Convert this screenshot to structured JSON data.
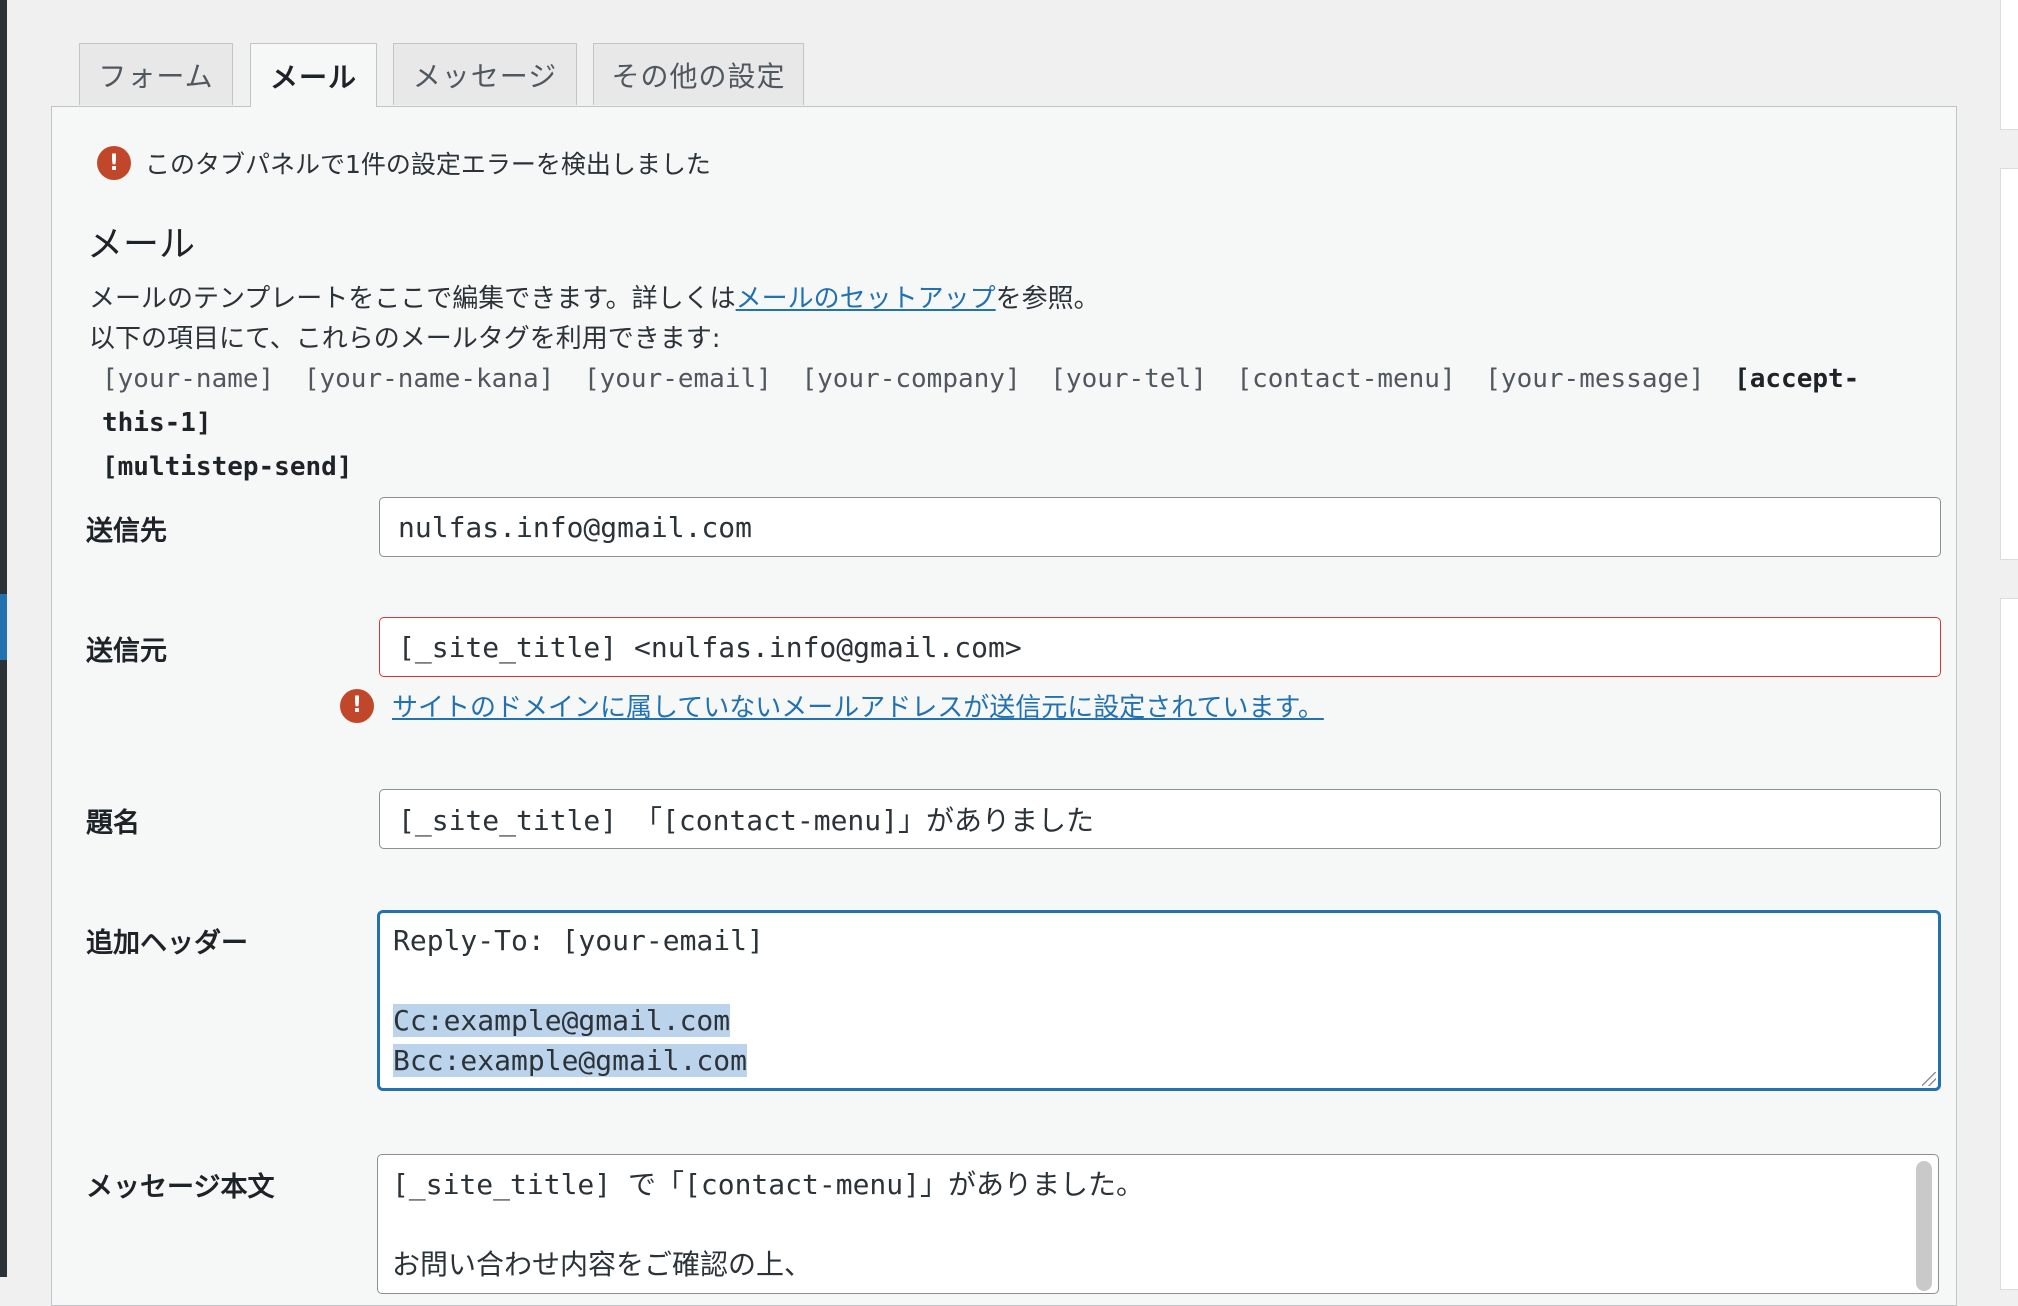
{
  "tabs": [
    {
      "label": "フォーム",
      "active": false
    },
    {
      "label": "メール",
      "active": true
    },
    {
      "label": "メッセージ",
      "active": false
    },
    {
      "label": "その他の設定",
      "active": false
    }
  ],
  "panel": {
    "error_summary": "このタブパネルで1件の設定エラーを検出しました",
    "section_title": "メール",
    "description_before_link": "メールのテンプレートをここで編集できます。詳しくは",
    "description_link": "メールのセットアップ",
    "description_after_link": "を参照。",
    "mailtags_intro": "以下の項目にて、これらのメールタグを利用できます:",
    "mailtags": [
      "[your-name]",
      "[your-name-kana]",
      "[your-email]",
      "[your-company]",
      "[your-tel]",
      "[contact-menu]",
      "[your-message]"
    ],
    "mailtags_used": [
      "[accept-this-1]",
      "[multistep-send]"
    ]
  },
  "fields": {
    "to": {
      "label": "送信先",
      "value": "nulfas.info@gmail.com"
    },
    "from": {
      "label": "送信元",
      "value": "[_site_title] <nulfas.info@gmail.com>",
      "error": "サイトのドメインに属していないメールアドレスが送信元に設定されています。"
    },
    "subject": {
      "label": "題名",
      "value": "[_site_title] 「[contact-menu]」がありました"
    },
    "headers": {
      "label": "追加ヘッダー",
      "line1": "Reply-To: [your-email]",
      "line2": "",
      "line3": "Cc:example@gmail.com",
      "line4": "Bcc:example@gmail.com"
    },
    "body": {
      "label": "メッセージ本文",
      "line1": "[_site_title] で「[contact-menu]」がありました。",
      "line2": "",
      "line3": "お問い合わせ内容をご確認の上、"
    }
  },
  "colors": {
    "accent": "#2271b1",
    "error": "#d63638",
    "error_icon": "#c1472b",
    "selection": "#bcd3ec"
  }
}
